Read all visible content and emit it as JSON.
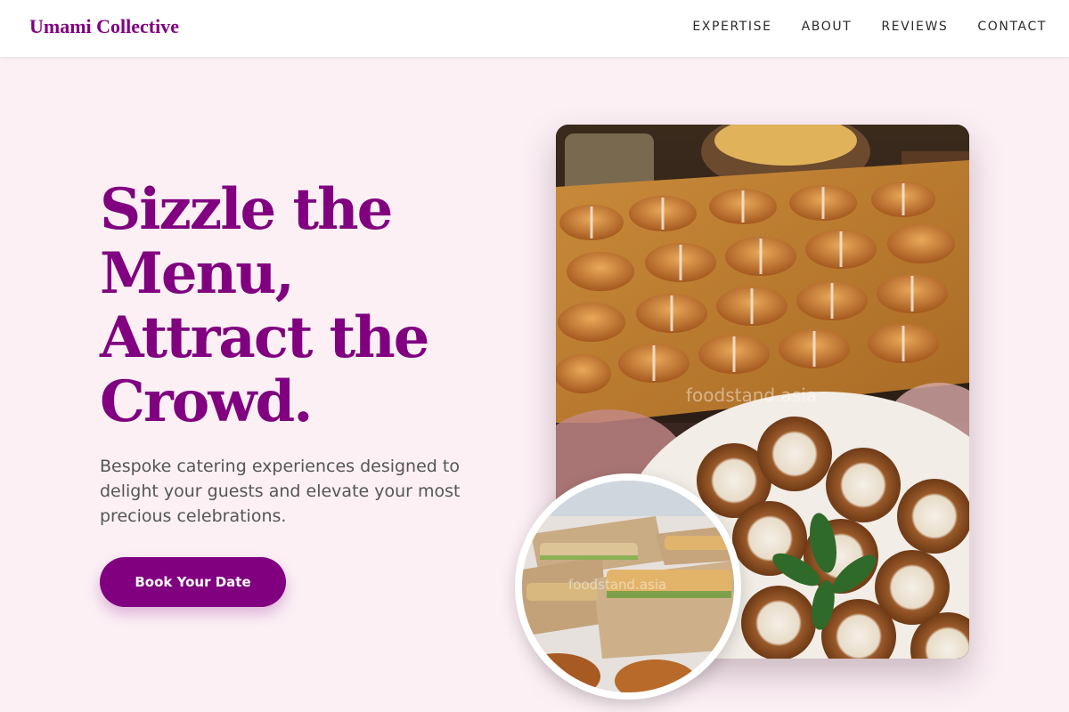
{
  "brand": {
    "name": "Umami Collective",
    "color": "#800080"
  },
  "nav": {
    "items": [
      "EXPERTISE",
      "ABOUT",
      "REVIEWS",
      "CONTACT"
    ]
  },
  "hero": {
    "headline_lines": [
      "Sizzle the",
      "Menu,",
      "Attract the",
      "Crowd."
    ],
    "subtitle": "Bespoke catering experiences designed to delight your guests and elevate your most precious celebrations.",
    "cta_label": "Book Your Date"
  },
  "images": {
    "main": {
      "semantic": "croissant-platter-photo",
      "watermark": "foodstand.asia"
    },
    "circle": {
      "semantic": "boxed-sandwiches-photo",
      "watermark": "foodstand.asia"
    }
  },
  "colors": {
    "background": "#fcf0f5",
    "header_bg": "#ffffff",
    "accent": "#800080",
    "body_text": "#555555"
  }
}
